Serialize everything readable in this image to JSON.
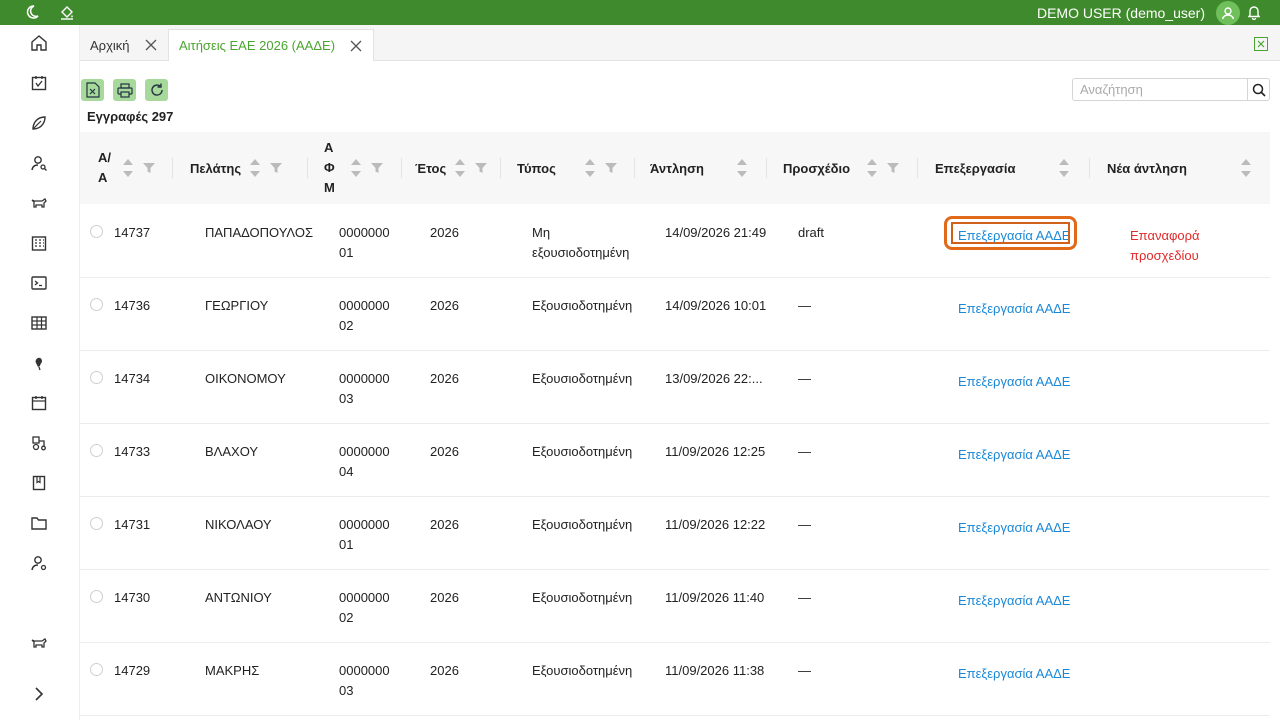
{
  "topbar": {
    "user_label": "DEMO USER (demo_user)",
    "icons": [
      "moon-icon",
      "paint-bucket-icon",
      "avatar",
      "bell-icon"
    ],
    "accent": "#3f8a2c"
  },
  "sidebar": {
    "items": [
      "home-icon",
      "calendar-check-icon",
      "leaf-icon",
      "user-search-icon",
      "cow-icon",
      "building-icon",
      "terminal-icon",
      "table-icon",
      "bug-icon",
      "calendar-icon",
      "tractor-icon",
      "book-icon",
      "folder-icon",
      "user-gear-icon",
      "cow-icon-2",
      "chevron-right-icon"
    ]
  },
  "tabs": [
    {
      "label": "Αρχική",
      "active": false
    },
    {
      "label": "Αιτήσεις ΕΑΕ 2026 (ΑΑΔΕ)",
      "active": true
    }
  ],
  "toolbar": {
    "icons": [
      "excel-export-icon",
      "print-icon",
      "refresh-icon"
    ],
    "records_label": "Εγγραφές 297"
  },
  "search": {
    "placeholder": "Αναζήτηση",
    "value": ""
  },
  "table": {
    "headers": {
      "aa": "Α/Α",
      "client": "Πελάτης",
      "afm": "ΑΦΜ",
      "year": "Έτος",
      "type": "Τύπος",
      "fetch": "Άντληση",
      "draft": "Προσχέδιο",
      "edit": "Επεξεργασία",
      "new_fetch": "Νέα άντληση"
    },
    "rows": [
      {
        "aa": "14737",
        "client": "ΠΑΠΑΔΟΠΟΥΛΟΣ",
        "afm1": "0000000",
        "afm2": "01",
        "year": "2026",
        "type1": "Μη",
        "type2": "εξουσιοδοτημένη",
        "fetch": "14/09/2026 21:49",
        "draft": "draft",
        "edit": "Επεξεργασία ΑΑΔΕ",
        "new_fetch": "Επαναφορά προσχεδίου"
      },
      {
        "aa": "14736",
        "client": "ΓΕΩΡΓΙΟΥ",
        "afm1": "0000000",
        "afm2": "02",
        "year": "2026",
        "type1": "Εξουσιοδοτημένη",
        "type2": "",
        "fetch": "14/09/2026 10:01",
        "draft": "—",
        "edit": "Επεξεργασία ΑΑΔΕ",
        "new_fetch": ""
      },
      {
        "aa": "14734",
        "client": "ΟΙΚΟΝΟΜΟΥ",
        "afm1": "0000000",
        "afm2": "03",
        "year": "2026",
        "type1": "Εξουσιοδοτημένη",
        "type2": "",
        "fetch": "13/09/2026 22:...",
        "draft": "—",
        "edit": "Επεξεργασία ΑΑΔΕ",
        "new_fetch": ""
      },
      {
        "aa": "14733",
        "client": "ΒΛΑΧΟΥ",
        "afm1": "0000000",
        "afm2": "04",
        "year": "2026",
        "type1": "Εξουσιοδοτημένη",
        "type2": "",
        "fetch": "11/09/2026 12:25",
        "draft": "—",
        "edit": "Επεξεργασία ΑΑΔΕ",
        "new_fetch": ""
      },
      {
        "aa": "14731",
        "client": "ΝΙΚΟΛΑΟΥ",
        "afm1": "0000000",
        "afm2": "01",
        "year": "2026",
        "type1": "Εξουσιοδοτημένη",
        "type2": "",
        "fetch": "11/09/2026 12:22",
        "draft": "—",
        "edit": "Επεξεργασία ΑΑΔΕ",
        "new_fetch": ""
      },
      {
        "aa": "14730",
        "client": "ΑΝΤΩΝΙΟΥ",
        "afm1": "0000000",
        "afm2": "02",
        "year": "2026",
        "type1": "Εξουσιοδοτημένη",
        "type2": "",
        "fetch": "11/09/2026 11:40",
        "draft": "—",
        "edit": "Επεξεργασία ΑΑΔΕ",
        "new_fetch": ""
      },
      {
        "aa": "14729",
        "client": "ΜΑΚΡΗΣ",
        "afm1": "0000000",
        "afm2": "03",
        "year": "2026",
        "type1": "Εξουσιοδοτημένη",
        "type2": "",
        "fetch": "11/09/2026 11:38",
        "draft": "—",
        "edit": "Επεξεργασία ΑΑΔΕ",
        "new_fetch": ""
      }
    ]
  },
  "colors": {
    "link": "#1a88d8",
    "reset": "#e22a2a",
    "highlight": "#e06a1a",
    "tool_bg": "#a6d99a"
  }
}
